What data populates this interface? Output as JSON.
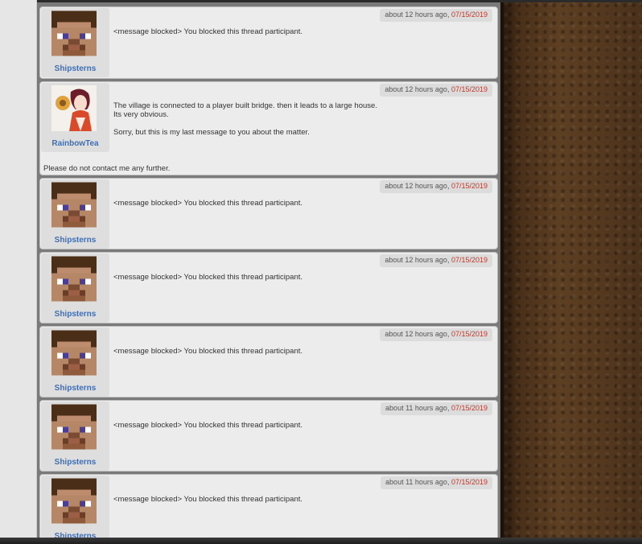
{
  "posts": [
    {
      "username": "Shipsterns",
      "avatar": "steve-head-icon",
      "time_relative": "about 12 hours ago, ",
      "date": "07/15/2019",
      "message": "<message blocked> You blocked this thread participant."
    },
    {
      "username": "RainbowTea",
      "avatar": "anime-girl-avatar",
      "time_relative": "about 12 hours ago, ",
      "date": "07/15/2019",
      "message_line1": "The village is connected to a player built bridge. then it leads to a large house.",
      "message_line2": "Its very obvious.",
      "message_line3": "Sorry, but this is my last message to you about the matter.",
      "message_footer": "Please do not contact me any further."
    },
    {
      "username": "Shipsterns",
      "avatar": "steve-head-icon",
      "time_relative": "about 12 hours ago, ",
      "date": "07/15/2019",
      "message": "<message blocked> You blocked this thread participant."
    },
    {
      "username": "Shipsterns",
      "avatar": "steve-head-icon",
      "time_relative": "about 12 hours ago, ",
      "date": "07/15/2019",
      "message": "<message blocked> You blocked this thread participant."
    },
    {
      "username": "Shipsterns",
      "avatar": "steve-head-icon",
      "time_relative": "about 12 hours ago, ",
      "date": "07/15/2019",
      "message": "<message blocked> You blocked this thread participant."
    },
    {
      "username": "Shipsterns",
      "avatar": "steve-head-icon",
      "time_relative": "about 11 hours ago, ",
      "date": "07/15/2019",
      "message": "<message blocked> You blocked this thread participant."
    },
    {
      "username": "Shipsterns",
      "avatar": "steve-head-icon",
      "time_relative": "about 11 hours ago, ",
      "date": "07/15/2019",
      "message": "<message blocked> You blocked this thread participant."
    }
  ],
  "colors": {
    "username": "#3d6fb6",
    "date": "#c0392b",
    "post_bg": "#ececec",
    "thread_bg": "#7a7a7a"
  }
}
